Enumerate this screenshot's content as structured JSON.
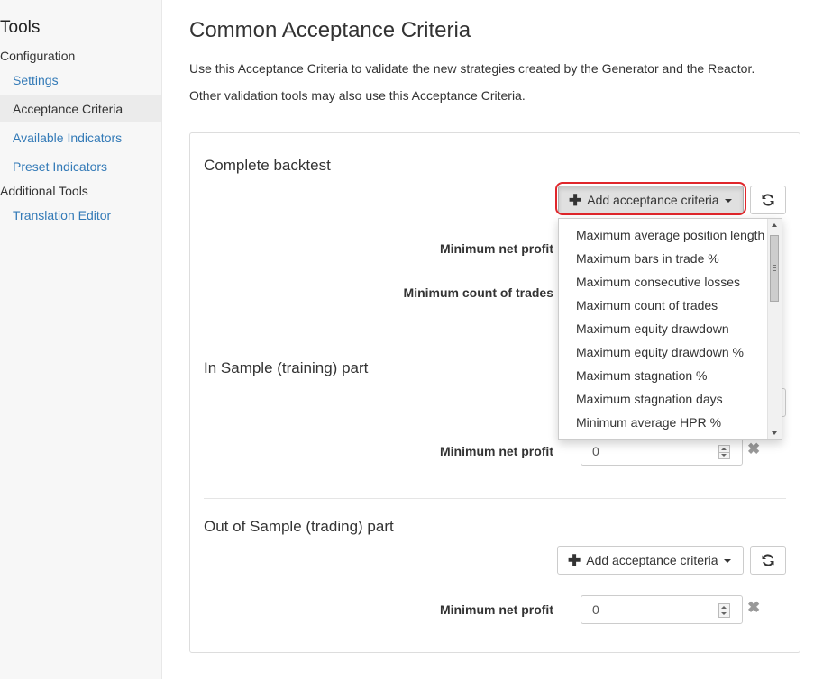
{
  "sidebar": {
    "title": "Tools",
    "group_configuration": "Configuration",
    "items": [
      {
        "label": "Settings"
      },
      {
        "label": "Acceptance Criteria"
      },
      {
        "label": "Available Indicators"
      },
      {
        "label": "Preset Indicators"
      }
    ],
    "group_additional": "Additional Tools",
    "additional_items": [
      {
        "label": "Translation Editor"
      }
    ]
  },
  "page": {
    "title": "Common Acceptance Criteria",
    "description_1": "Use this Acceptance Criteria to validate the new strategies created by the Generator and the Reactor.",
    "description_2": "Other validation tools may also use this Acceptance Criteria."
  },
  "sections": [
    {
      "title": "Complete backtest",
      "add_label": "Add acceptance criteria",
      "fields": [
        {
          "label": "Minimum net profit"
        },
        {
          "label": "Minimum count of trades"
        }
      ]
    },
    {
      "title": "In Sample (training) part",
      "fields": [
        {
          "label": "Minimum net profit",
          "value": "0"
        }
      ]
    },
    {
      "title": "Out of Sample (trading) part",
      "add_label": "Add acceptance criteria",
      "fields": [
        {
          "label": "Minimum net profit",
          "value": "0"
        }
      ]
    }
  ],
  "dropdown": {
    "items": [
      "Maximum average position length",
      "Maximum bars in trade %",
      "Maximum consecutive losses",
      "Maximum count of trades",
      "Maximum equity drawdown",
      "Maximum equity drawdown %",
      "Maximum stagnation %",
      "Maximum stagnation days",
      "Minimum average HPR %"
    ]
  },
  "colors": {
    "link": "#337ab7",
    "highlight": "#e0262b",
    "sidebar_bg": "#f7f7f7"
  }
}
